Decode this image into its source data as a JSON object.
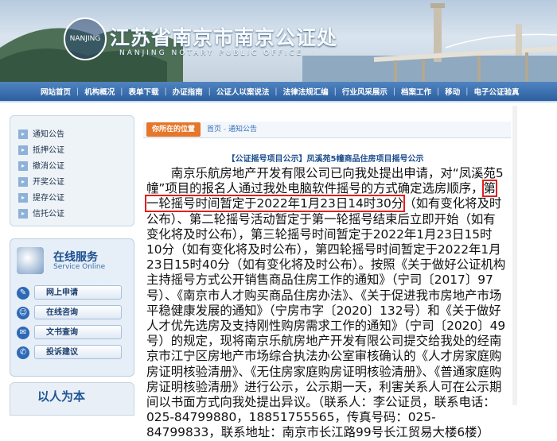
{
  "banner": {
    "title": "江苏省南京市南京公证处",
    "subtitle": "NANJING NOTARY PUBLIC OFFICE",
    "seal_text": "NANJING"
  },
  "nav": {
    "items": [
      "网站首页",
      "机构概况",
      "表单下载",
      "办证指南",
      "公证人以案说法",
      "法律法规汇编",
      "行业风采展示",
      "档案工作",
      "移动",
      "电子公证验真"
    ]
  },
  "sidebar": {
    "items": [
      {
        "num": "",
        "label": "通知公告"
      },
      {
        "num": "",
        "label": "抵押公证"
      },
      {
        "num": "",
        "label": "撤消公证"
      },
      {
        "num": "",
        "label": "开奖公证"
      },
      {
        "num": "",
        "label": "提存公证"
      },
      {
        "num": "",
        "label": "信托公证"
      }
    ]
  },
  "service": {
    "title": "在线服务",
    "subtitle": "Service Online",
    "items": [
      "网上申请",
      "在线咨询",
      "文书查询",
      "投诉建议"
    ]
  },
  "slogan": "以人为本",
  "breadcrumb": {
    "tag": "你所在的位置",
    "home": "首页",
    "separator": "-",
    "current": "通知公告"
  },
  "article": {
    "title": "【公证摇号项目公示】凤溪苑5幢商品住房项目摇号公示",
    "before_highlight": "南京乐航房地产开发有限公司已向我处提出申请，对“凤溪苑5幢”项目的报名人通过我处电脑软件摇号的方式确定选房顺序，",
    "highlight": "第一轮摇号时间暂定于2022年1月23日14时30分",
    "after_highlight": "（如有变化将及时公布）、第二轮摇号活动暂定于第一轮摇号结束后立即开始（如有变化将及时公布），第三轮摇号时间暂定于2022年1月23日15时10分（如有变化将及时公布），第四轮摇号时间暂定于2022年1月23日15时40分（如有变化将及时公布）。按照《关于做好公证机构主持摇号方式公开销售商品住房工作的通知》（宁司〔2017〕97号）、《南京市人才购买商品住房办法》、《关于促进我市房地产市场平稳健康发展的通知》（宁房市字〔2020〕132号）和《关于做好人才优先选房及支持刚性购房需求工作的通知》（宁司〔2020〕49号）的规定，现将南京乐航房地产开发有限公司提交给我处的经南京市江宁区房地产市场综合执法办公室审核确认的《人才房家庭购房证明核验清册》、《无住房家庭购房证明核验清册》、《普通家庭购房证明核验清册》进行公示，公示期一天，利害关系人可在公示期间以书面方式向我处提出异议。（联系人：李公证员，联系电话：025-84799880，18851755565，传真号码：025-84799833，联系地址：南京市长江路99号长江贸易大楼6楼）"
  },
  "colors": {
    "nav_bg": "#2d5f9e",
    "crumb_tag": "#e5762a",
    "highlight_border": "#e02020",
    "title_blue": "#1e4f8f"
  }
}
